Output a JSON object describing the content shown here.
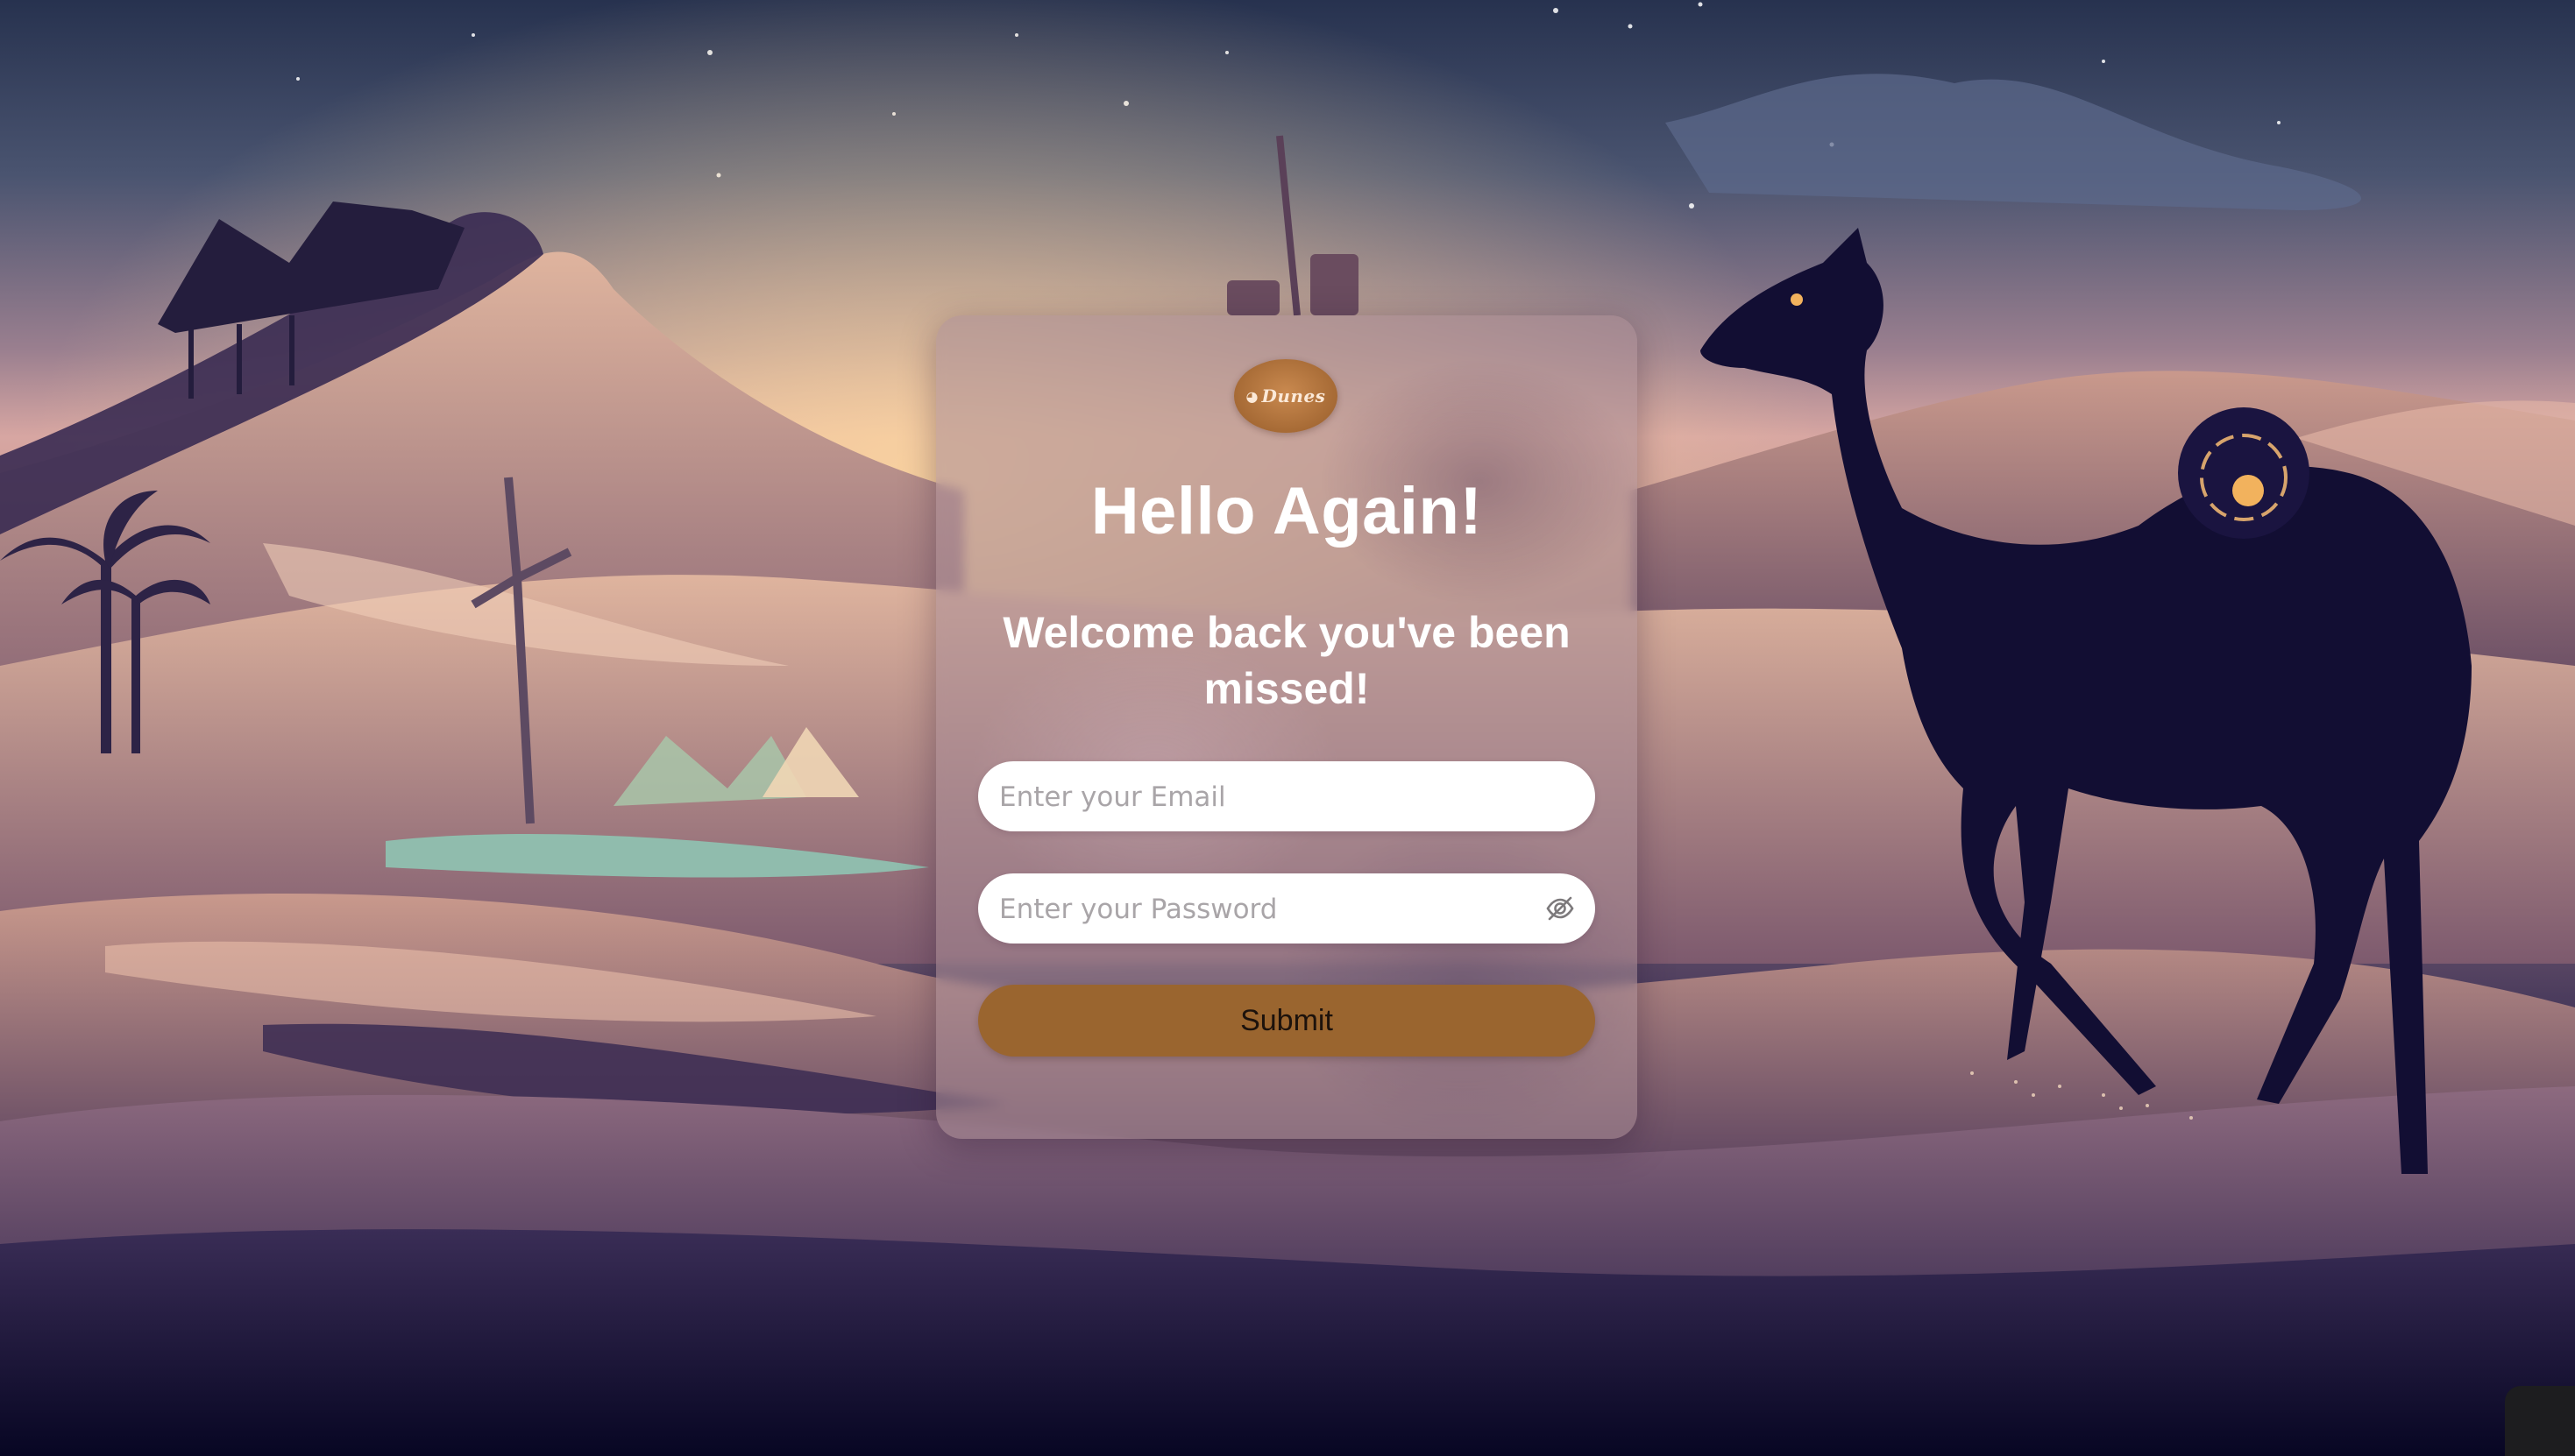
{
  "brand": {
    "logo_text": "Dunes"
  },
  "login": {
    "title": "Hello Again!",
    "subtitle": "Welcome back you've been missed!",
    "email_placeholder": "Enter your Email",
    "password_placeholder": "Enter your Password",
    "submit_label": "Submit"
  },
  "colors": {
    "accent": "#9a652f",
    "logo": "#a66a35",
    "field_bg": "#ffffff",
    "text_on_card": "#ffffff"
  },
  "icons": {
    "password_toggle": "eye-off-icon",
    "logo": "dunes-logo-icon"
  }
}
